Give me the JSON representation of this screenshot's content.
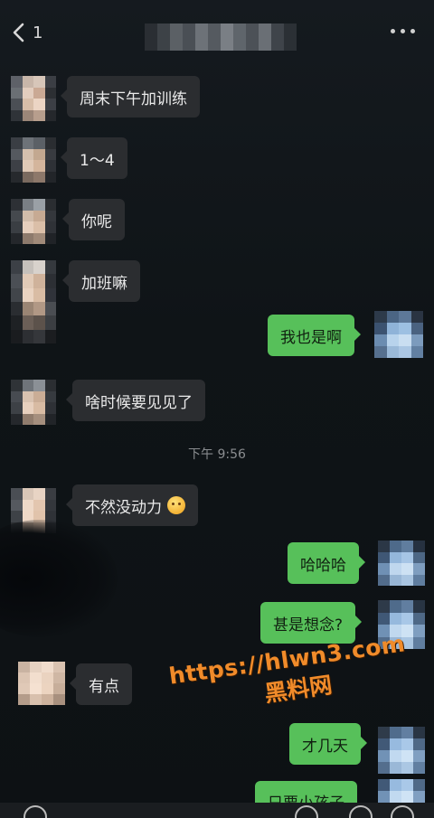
{
  "header": {
    "back_count": "1",
    "back_icon": "chevron-left-icon",
    "more_icon": "more-dots-icon"
  },
  "messages": [
    {
      "side": "left",
      "text": "周末下午加训练"
    },
    {
      "side": "left",
      "text": "1～4"
    },
    {
      "side": "left",
      "text": "你呢"
    },
    {
      "side": "left",
      "text": "加班嘛"
    },
    {
      "side": "right",
      "text": "我也是啊"
    },
    {
      "side": "left",
      "text": "啥时候要见见了"
    },
    {
      "side": "left",
      "text": "不然没动力"
    },
    {
      "side": "right",
      "text": "哈哈哈"
    },
    {
      "side": "right",
      "text": "甚是想念?"
    },
    {
      "side": "left",
      "text": "有点"
    },
    {
      "side": "right",
      "text": "才几天"
    },
    {
      "side": "right",
      "text": "只要小孩子"
    }
  ],
  "timestamp": "下午 9:56",
  "watermark": {
    "url": "https://hlwn3.com",
    "site": "黑料网",
    "color": "#f08b2a"
  },
  "colors": {
    "background": "#0f1316",
    "bubble_left": "#2b2d30",
    "bubble_right": "#57c05a"
  }
}
